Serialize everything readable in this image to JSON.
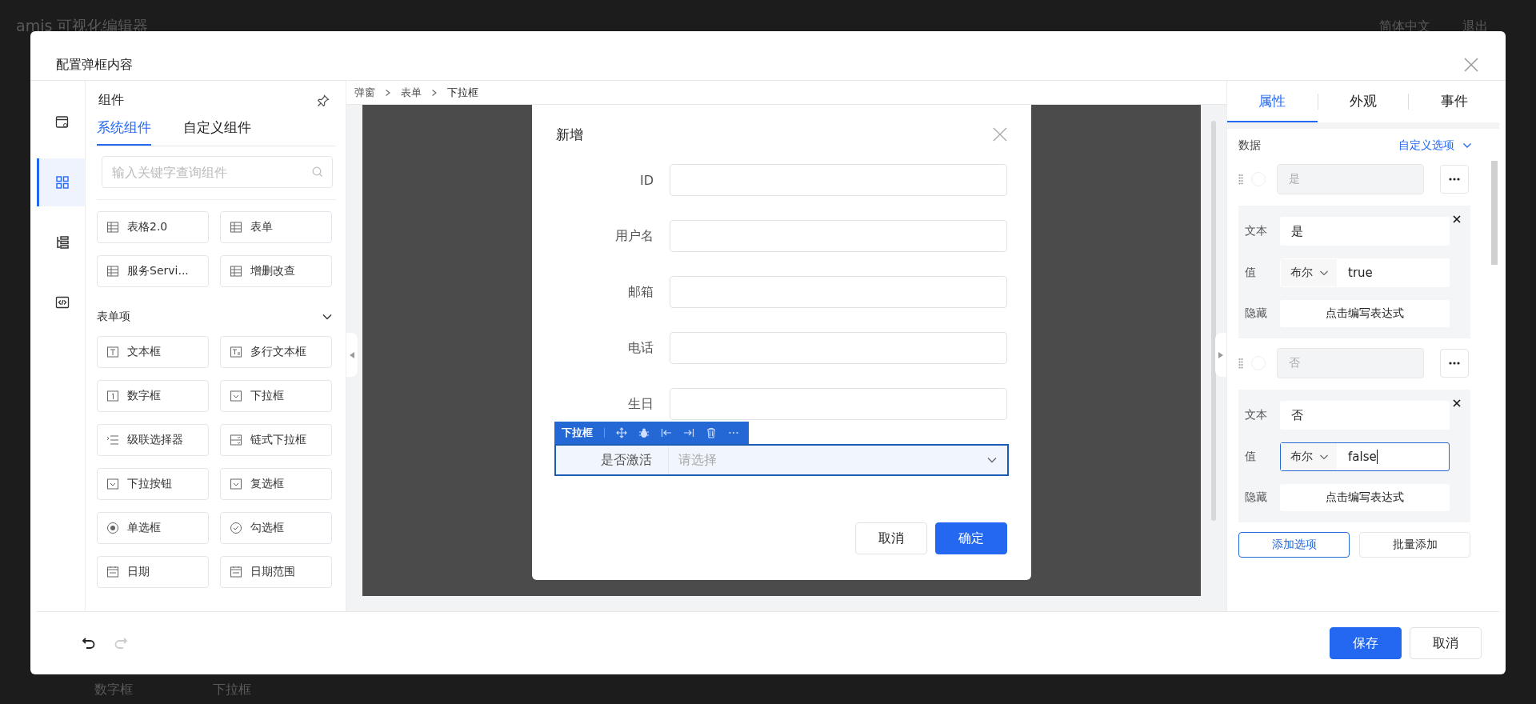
{
  "background": {
    "title": "amis 可视化编辑器",
    "language": "简体中文",
    "logout": "退出",
    "items": [
      "数字框",
      "下拉框"
    ]
  },
  "dialog": {
    "title": "配置弹框内容"
  },
  "rail": [
    {
      "selected": false
    },
    {
      "selected": true
    },
    {
      "selected": false
    },
    {
      "selected": false
    }
  ],
  "components": {
    "title": "组件",
    "tabs": [
      {
        "label": "系统组件",
        "selected": true
      },
      {
        "label": "自定义组件",
        "selected": false
      }
    ],
    "search": {
      "placeholder": "输入关键字查询组件"
    },
    "groups": [
      {
        "items": [
          "表格2.0",
          "表单",
          "服务Servi...",
          "增删改查"
        ]
      },
      {
        "title": "表单项",
        "expanded": true,
        "items": [
          "文本框",
          "多行文本框",
          "数字框",
          "下拉框",
          "级联选择器",
          "链式下拉框",
          "下拉按钮",
          "复选框",
          "单选框",
          "勾选框",
          "日期",
          "日期范围"
        ]
      }
    ]
  },
  "breadcrumb": [
    "弹窗",
    "表单",
    "下拉框"
  ],
  "form": {
    "title": "新增",
    "fields": [
      {
        "label": "ID",
        "kind": "input",
        "selected": false
      },
      {
        "label": "用户名",
        "kind": "input",
        "selected": false
      },
      {
        "label": "邮箱",
        "kind": "input",
        "selected": false
      },
      {
        "label": "电话",
        "kind": "input",
        "selected": false
      },
      {
        "label": "生日",
        "kind": "input",
        "selected": false
      },
      {
        "label": "是否激活",
        "kind": "select",
        "placeholder": "请选择",
        "selected": true,
        "toolbar": "下拉框"
      }
    ],
    "buttons": [
      {
        "label": "取消",
        "primary": false
      },
      {
        "label": "确定",
        "primary": true
      }
    ]
  },
  "inspector": {
    "tabs": [
      {
        "label": "属性",
        "selected": true
      },
      {
        "label": "外观",
        "selected": false
      },
      {
        "label": "事件",
        "selected": false
      }
    ],
    "section": "数据",
    "source": "自定义选项",
    "options": [
      {
        "label": "是",
        "checked": false,
        "text_label": "文本",
        "text": "是",
        "value_label": "值",
        "type": "布尔",
        "value": "true",
        "hidden_label": "隐藏",
        "expression": "点击编写表达式",
        "focused": false
      },
      {
        "label": "否",
        "checked": false,
        "text_label": "文本",
        "text": "否",
        "value_label": "值",
        "type": "布尔",
        "value": "false",
        "hidden_label": "隐藏",
        "expression": "点击编写表达式",
        "focused": true
      }
    ],
    "actions": [
      "添加选项",
      "批量添加"
    ]
  },
  "history": {
    "undo_disabled": false,
    "redo_disabled": true
  },
  "footer": {
    "buttons": [
      {
        "label": "保存",
        "primary": true
      },
      {
        "label": "取消",
        "primary": false
      }
    ]
  }
}
